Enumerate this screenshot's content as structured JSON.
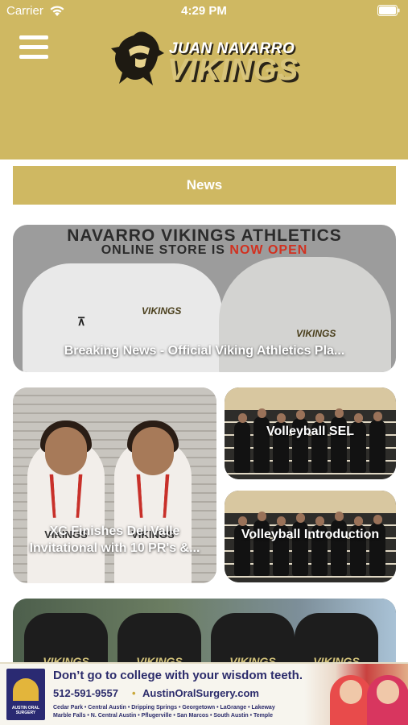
{
  "status_bar": {
    "carrier": "Carrier",
    "time": "4:29 PM",
    "wifi_icon": "wifi-icon",
    "battery_icon": "battery-icon"
  },
  "header": {
    "menu_icon": "hamburger-menu-icon",
    "logo_line1": "JUAN NAVARRO",
    "logo_line2": "VIKINGS",
    "background_color": "#cfb862"
  },
  "section": {
    "title": "News"
  },
  "featured": {
    "image_headline": "NAVARRO VIKINGS ATHLETICS",
    "image_sub_prefix": "ONLINE STORE IS ",
    "image_sub_highlight": "NOW OPEN",
    "shirt_brand_mark": "⊼",
    "shirt_logo_left": "VIKINGS",
    "shirt_logo_right": "VIKINGS",
    "caption": "Breaking News - Official Viking Athletics Pla..."
  },
  "cards": {
    "xc": {
      "jersey_left": "VIKINGS",
      "jersey_right": "VIKINGS",
      "caption": "XC Finishes Del Valle Invitational with 10 PR's &..."
    },
    "volleyball_sel": {
      "caption": "Volleyball SEL"
    },
    "volleyball_intro": {
      "caption": "Volleyball Introduction"
    },
    "bottom": {
      "jerseys": [
        "VIKINGS",
        "VIKINGS",
        "VIKINGS",
        "VIKINGS"
      ]
    }
  },
  "ad": {
    "logo_label": "AUSTIN ORAL SURGERY",
    "headline": "Don’t go to college with your wisdom teeth.",
    "phone": "512-591-9557",
    "separator": "•",
    "website": "AustinOralSurgery.com",
    "locations_line1": "Cedar Park • Central Austin • Dripping Springs • Georgetown • LaGrange • Lakeway",
    "locations_line2": "Marble Falls • N. Central Austin • Pflugerville • San Marcos • South Austin • Temple"
  }
}
